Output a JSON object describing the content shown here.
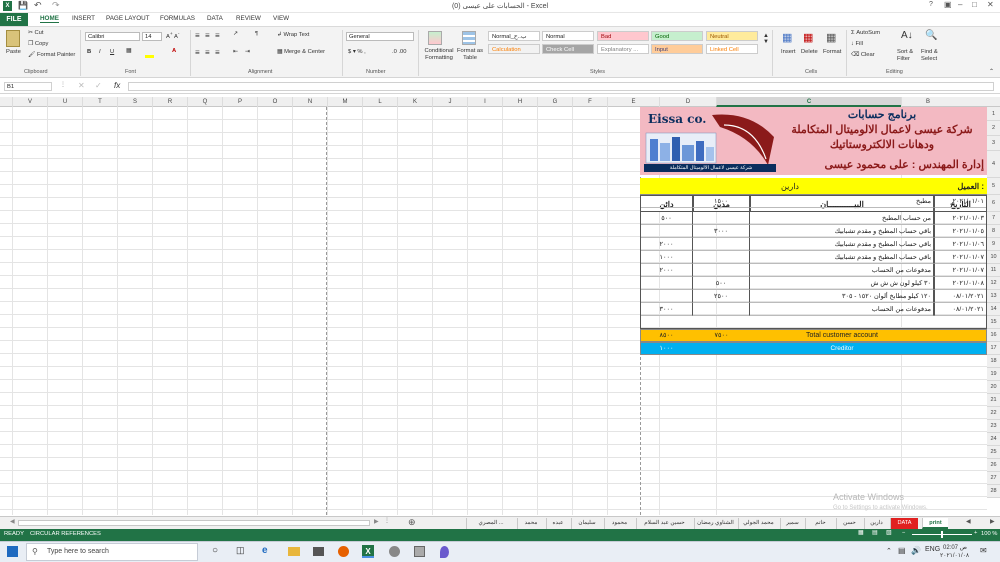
{
  "window": {
    "title": "الحسابات على عيسى (0) - Excel",
    "help": "?"
  },
  "ribbon_tabs": [
    "FILE",
    "HOME",
    "INSERT",
    "PAGE LAYOUT",
    "FORMULAS",
    "DATA",
    "REVIEW",
    "VIEW"
  ],
  "clipboard": {
    "paste": "Paste",
    "cut": "Cut",
    "copy": "Copy",
    "format_painter": "Format Painter",
    "label": "Clipboard"
  },
  "font": {
    "name": "Calibri",
    "size": "14",
    "label": "Font"
  },
  "alignment": {
    "wrap": "Wrap Text",
    "merge": "Merge & Center",
    "label": "Alignment"
  },
  "number": {
    "format": "General",
    "label": "Number"
  },
  "styles": {
    "conditional": "Conditional Formatting",
    "format_as_table": "Format as Table",
    "items": [
      {
        "label": "Normal_ب..ح",
        "bg": "#ffffff",
        "fg": "#222222"
      },
      {
        "label": "Normal",
        "bg": "#ffffff",
        "fg": "#222222"
      },
      {
        "label": "Bad",
        "bg": "#ffc7ce",
        "fg": "#9c0006"
      },
      {
        "label": "Good",
        "bg": "#c6efce",
        "fg": "#006100"
      },
      {
        "label": "Neutral",
        "bg": "#ffeb9c",
        "fg": "#9c5700"
      },
      {
        "label": "Calculation",
        "bg": "#f2f2f2",
        "fg": "#fa7d00"
      },
      {
        "label": "Check Cell",
        "bg": "#a5a5a5",
        "fg": "#ffffff"
      },
      {
        "label": "Explanatory ...",
        "bg": "#ffffff",
        "fg": "#7f7f7f"
      },
      {
        "label": "Input",
        "bg": "#ffcc99",
        "fg": "#3f3f76"
      },
      {
        "label": "Linked Cell",
        "bg": "#ffffff",
        "fg": "#fa7d00"
      }
    ],
    "label": "Styles"
  },
  "cells_group": {
    "insert": "Insert",
    "delete": "Delete",
    "format": "Format",
    "label": "Cells"
  },
  "editing": {
    "autosum": "AutoSum",
    "fill": "Fill",
    "clear": "Clear",
    "sort": "Sort & Filter",
    "find": "Find & Select",
    "label": "Editing"
  },
  "formula_bar": {
    "name_box": "B1",
    "fx": "fx",
    "formula": ""
  },
  "columns": [
    "V",
    "U",
    "T",
    "S",
    "R",
    "Q",
    "P",
    "O",
    "N",
    "M",
    "L",
    "K",
    "J",
    "I",
    "H",
    "G",
    "F",
    "E",
    "D",
    "C",
    "B",
    "A"
  ],
  "rows": [
    "1",
    "2",
    "3",
    "4",
    "5",
    "6",
    "7",
    "8",
    "9",
    "10",
    "11",
    "12",
    "13",
    "14",
    "15",
    "16",
    "17",
    "18",
    "19",
    "20",
    "21",
    "22",
    "23",
    "24",
    "25",
    "26",
    "27",
    "28"
  ],
  "banner": {
    "line1": "برنامج حسابات",
    "line2": "شركة عيسى لاعمال الالوميتال المتكاملة",
    "line3": "ودهانات الالكتروستاتيك",
    "line4": "إدارة المهندس : على محمود عيسى",
    "logo_text": "Eissa co.",
    "logo_caption": "شركة عيسى لاعمال الالوميتال المتكاملة"
  },
  "client": {
    "label": "العميل :",
    "value": "دارين"
  },
  "headers": {
    "date": "التاريخ",
    "desc": "البيـــــــــــان",
    "debit": "مدين",
    "credit": "دائن"
  },
  "entries": [
    {
      "row": 6,
      "date": "٢٠٢١/٠١/٠١",
      "desc": "مطبخ",
      "debit": "١٥٠٠",
      "credit": ""
    },
    {
      "row": 7,
      "date": "٢٠٢١/٠١/٠٣",
      "desc": "من حساب المطبخ",
      "debit": "",
      "credit": "٥٠٠"
    },
    {
      "row": 8,
      "date": "٢٠٢١/٠١/٠٥",
      "desc": "باقي حساب المطبخ و مقدم تشبابيك",
      "debit": "٣٠٠٠",
      "credit": ""
    },
    {
      "row": 9,
      "date": "٢٠٢١/٠١/٠٦",
      "desc": "باقي حساب المطبخ و مقدم تشبابيك",
      "debit": "",
      "credit": "٢٠٠٠"
    },
    {
      "row": 10,
      "date": "٢٠٢١/٠١/٠٧",
      "desc": "باقي حساب المطبخ و مقدم تشبابيك",
      "debit": "",
      "credit": "١٠٠٠"
    },
    {
      "row": 11,
      "date": "٢٠٢١/٠١/٠٧",
      "desc": "مدفوعات من الحساب",
      "debit": "",
      "credit": "٢٠٠٠"
    },
    {
      "row": 12,
      "date": "٢٠٢١/٠١/٠٨",
      "desc": "٣٠ كيلو لون ش ش ش",
      "debit": "٥٠٠",
      "credit": ""
    },
    {
      "row": 13,
      "date": "٠٨/٠١/٢٠٢١",
      "desc": "١٢٠ كيلو مطابخ ألوان ١٥٢٠ - ٣٠٥",
      "debit": "٢٥٠٠",
      "credit": ""
    },
    {
      "row": 14,
      "date": "٠٨/٠١/٢٠٢١",
      "desc": "مدفوعات من الحساب",
      "debit": "",
      "credit": "٣٠٠٠"
    }
  ],
  "totals": {
    "label": "Total customer account",
    "debit": "٧٥٠٠",
    "credit": "٨٥٠٠"
  },
  "creditor": {
    "label": "Creditor",
    "value": "١٠٠٠"
  },
  "sheet_tabs": [
    "print",
    "DATA",
    "دارين",
    "حسن درة",
    "حاتم محمود",
    "سمير",
    "محمد الجولي",
    "الشناوي رمضان",
    "حسين عبد السلام",
    "محمود",
    "سليمان",
    "عبده",
    "محمد",
    "المصري ..."
  ],
  "active_sheet": "print",
  "status": {
    "ready": "READY",
    "circular": "CIRCULAR REFERENCES",
    "zoom": "100 %"
  },
  "watermark": {
    "line1": "Activate Windows",
    "line2": "Go to Settings to activate Windows."
  },
  "taskbar": {
    "search_placeholder": "Type here to search",
    "time": "02:07 ص",
    "date": "٢٠٢١/٠١/٠٨"
  }
}
